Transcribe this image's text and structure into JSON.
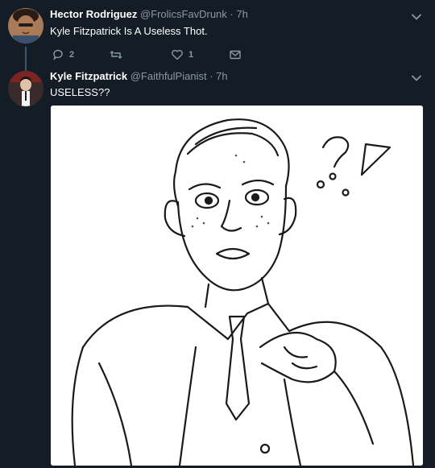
{
  "tweet1": {
    "name": "Hector Rodriguez",
    "handle": "@FrolicsFavDrunk",
    "time": "· 7h",
    "text": "Kyle Fitzpatrick Is A Useless Thot.",
    "reply_count": "2",
    "like_count": "1"
  },
  "tweet2": {
    "name": "Kyle Fitzpatrick",
    "handle": "@FaithfulPianist",
    "time": "· 7h",
    "text": "USELESS??"
  },
  "colors": {
    "background": "#141d26",
    "secondary_text": "#8899a6",
    "primary_text": "#ffffff"
  },
  "icons": [
    "chevron-down-icon",
    "reply-icon",
    "retweet-icon",
    "like-icon",
    "message-icon"
  ]
}
